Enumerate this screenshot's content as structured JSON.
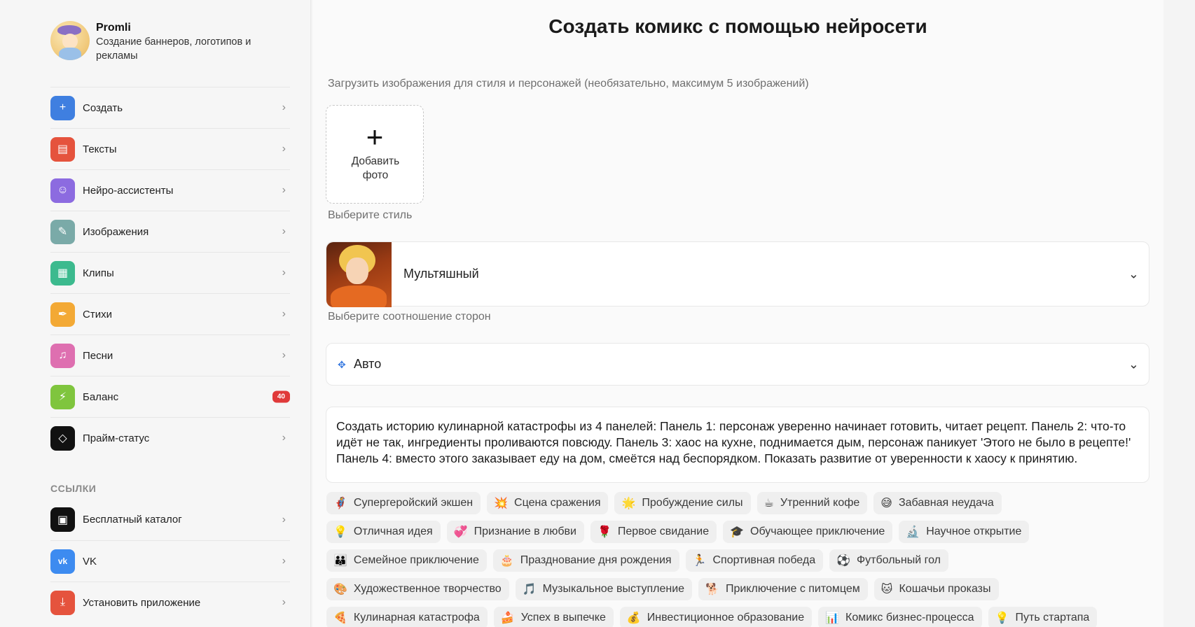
{
  "brand": {
    "name": "Promli",
    "subtitle": "Создание баннеров, логотипов и рекламы"
  },
  "nav": [
    {
      "label": "Создать",
      "icon": "plus-icon",
      "color": "#3f7fe0"
    },
    {
      "label": "Тексты",
      "icon": "document-icon",
      "color": "#e5533d"
    },
    {
      "label": "Нейро-ассистенты",
      "icon": "smile-icon",
      "color": "#8c6be0"
    },
    {
      "label": "Изображения",
      "icon": "brush-icon",
      "color": "#7aaaa8"
    },
    {
      "label": "Клипы",
      "icon": "film-icon",
      "color": "#3cba8e"
    },
    {
      "label": "Стихи",
      "icon": "feather-icon",
      "color": "#f3a935"
    },
    {
      "label": "Песни",
      "icon": "music-icon",
      "color": "#de6fb0"
    },
    {
      "label": "Баланс",
      "icon": "bolt-icon",
      "color": "#7fc53e",
      "badge": "40"
    },
    {
      "label": "Прайм-статус",
      "icon": "diamond-icon",
      "color": "#111111"
    }
  ],
  "links_title": "ССЫЛКИ",
  "links": [
    {
      "label": "Бесплатный каталог",
      "icon": "gallery-icon",
      "color": "#111111"
    },
    {
      "label": "VK",
      "icon": "vk-icon",
      "color": "#3d8bf0"
    },
    {
      "label": "Установить приложение",
      "icon": "download-icon",
      "color": "#e5533d"
    }
  ],
  "main": {
    "title": "Создать комикс с помощью нейросети",
    "upload_label": "Загрузить изображения для стиля и персонажей (необязательно, максимум 5 изображений)",
    "add_photo": "Добавить фото",
    "style_label": "Выберите стиль",
    "style_value": "Мультяшный",
    "ratio_label": "Выберите соотношение сторон",
    "ratio_value": "Авто",
    "prompt": "Создать историю кулинарной катастрофы из 4 панелей: Панель 1: персонаж уверенно начинает готовить, читает рецепт. Панель 2: что-то идёт не так, ингредиенты проливаются повсюду. Панель 3: хаос на кухне, поднимается дым, персонаж паникует 'Этого не было в рецепте!' Панель 4: вместо этого заказывает еду на дом, смеётся над беспорядком. Показать развитие от уверенности к хаосу к принятию."
  },
  "chips": [
    [
      {
        "e": "🦸",
        "t": "Супергеройский экшен"
      },
      {
        "e": "💥",
        "t": "Сцена сражения"
      },
      {
        "e": "🌟",
        "t": "Пробуждение силы"
      },
      {
        "e": "☕",
        "t": "Утренний кофе"
      },
      {
        "e": "😅",
        "t": "Забавная неудача"
      }
    ],
    [
      {
        "e": "💡",
        "t": "Отличная идея"
      },
      {
        "e": "💞",
        "t": "Признание в любви"
      },
      {
        "e": "🌹",
        "t": "Первое свидание"
      },
      {
        "e": "🎓",
        "t": "Обучающее приключение"
      },
      {
        "e": "🔬",
        "t": "Научное открытие"
      }
    ],
    [
      {
        "e": "👪",
        "t": "Семейное приключение"
      },
      {
        "e": "🎂",
        "t": "Празднование дня рождения"
      },
      {
        "e": "🏃",
        "t": "Спортивная победа"
      },
      {
        "e": "⚽",
        "t": "Футбольный гол"
      }
    ],
    [
      {
        "e": "🎨",
        "t": "Художественное творчество"
      },
      {
        "e": "🎵",
        "t": "Музыкальное выступление"
      },
      {
        "e": "🐕",
        "t": "Приключение с питомцем"
      },
      {
        "e": "🐱",
        "t": "Кошачьи проказы"
      }
    ],
    [
      {
        "e": "🍕",
        "t": "Кулинарная катастрофа"
      },
      {
        "e": "🍰",
        "t": "Успех в выпечке"
      },
      {
        "e": "💰",
        "t": "Инвестиционное образование"
      },
      {
        "e": "📊",
        "t": "Комикс бизнес-процесса"
      },
      {
        "e": "💡",
        "t": "Путь стартапа"
      }
    ]
  ]
}
